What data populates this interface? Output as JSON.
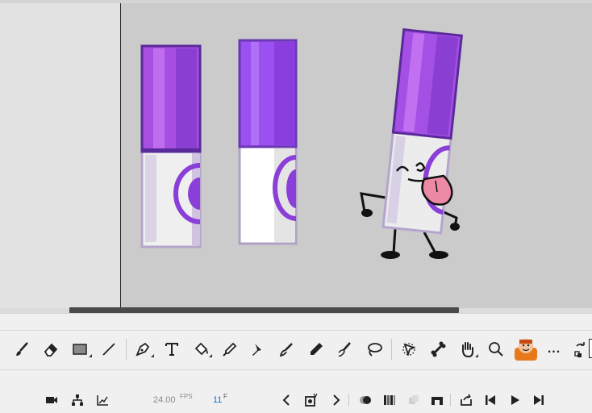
{
  "toolbar": {
    "tools": [
      "brush",
      "eraser",
      "rectangle",
      "line",
      "pen",
      "text",
      "paint-bucket",
      "eyedropper",
      "asset-warp",
      "fluid-brush",
      "pencil",
      "classic-brush",
      "lasso",
      "selection",
      "bone",
      "hand",
      "zoom",
      "character",
      "more"
    ],
    "more_label": "..."
  },
  "timeline": {
    "fps_value": "24.00",
    "fps_unit": "FPS",
    "frame_value": "11",
    "frame_unit": "F"
  },
  "colors": {
    "marker_purple": "#8a3fd8",
    "marker_cap_dark": "#5a2a9a",
    "tongue_pink": "#ec8aa6",
    "stage": "#cbcbcb",
    "pasteboard": "#e2e2e2"
  }
}
